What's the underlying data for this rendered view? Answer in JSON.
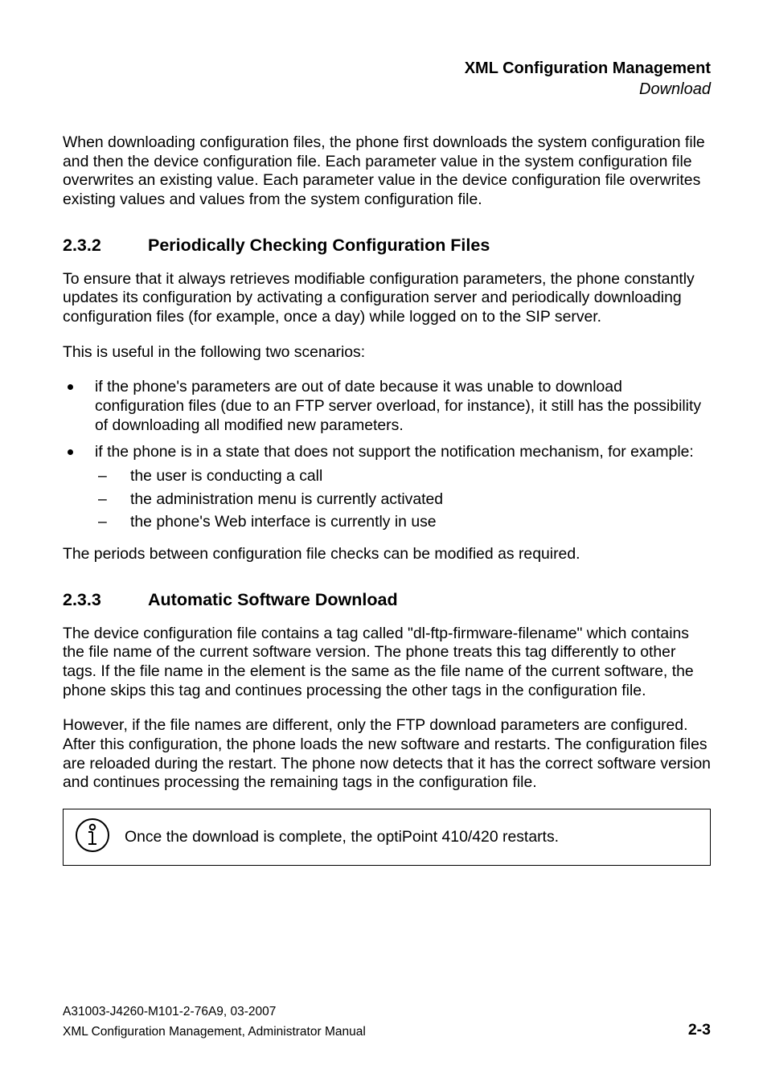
{
  "header": {
    "title": "XML Configuration Management",
    "subtitle": "Download"
  },
  "intro_para": "When downloading configuration files, the phone first downloads the system configuration file and then the device configuration file. Each parameter value in the system configuration file overwrites an existing value. Each parameter value in the device configuration file overwrites existing values and values from the system configuration file.",
  "sec232": {
    "num": "2.3.2",
    "title": "Periodically Checking Configuration Files",
    "p1": "To ensure that it always retrieves modifiable configuration parameters, the phone constantly updates its configuration by activating a configuration server and periodically downloading configuration files (for example, once a day) while logged on to the SIP server.",
    "p2": "This is useful in the following two scenarios:",
    "bullets": [
      "if the phone's parameters are out of date because it was unable to download configuration files (due to an FTP server overload, for instance), it still has the possibility of downloading all modified new parameters.",
      "if the phone is in a state that does not support the notification mechanism, for example:"
    ],
    "dashes": [
      "the user is conducting a call",
      "the administration menu is currently activated",
      "the phone's Web interface is currently in use"
    ],
    "p3": "The periods between configuration file checks can be modified as required."
  },
  "sec233": {
    "num": "2.3.3",
    "title": "Automatic Software Download",
    "p1": "The device configuration file contains a tag called \"dl-ftp-firmware-filename\" which contains the file name of the current software version. The phone treats this tag differently to other tags. If the file name in the element is the same as the file name of the current software, the phone skips this tag and continues processing the other tags in the configuration file.",
    "p2": "However, if the file names are different, only the FTP download parameters are configured. After this configuration, the phone loads the new software and restarts. The configuration files are reloaded during the restart. The phone now detects that it has the correct software version and continues processing the remaining tags in the configuration file.",
    "note": "Once the download is complete, the optiPoint 410/420 restarts."
  },
  "footer": {
    "line1": "A31003-J4260-M101-2-76A9, 03-2007",
    "line2": "XML Configuration Management, Administrator Manual",
    "page": "2-3"
  }
}
